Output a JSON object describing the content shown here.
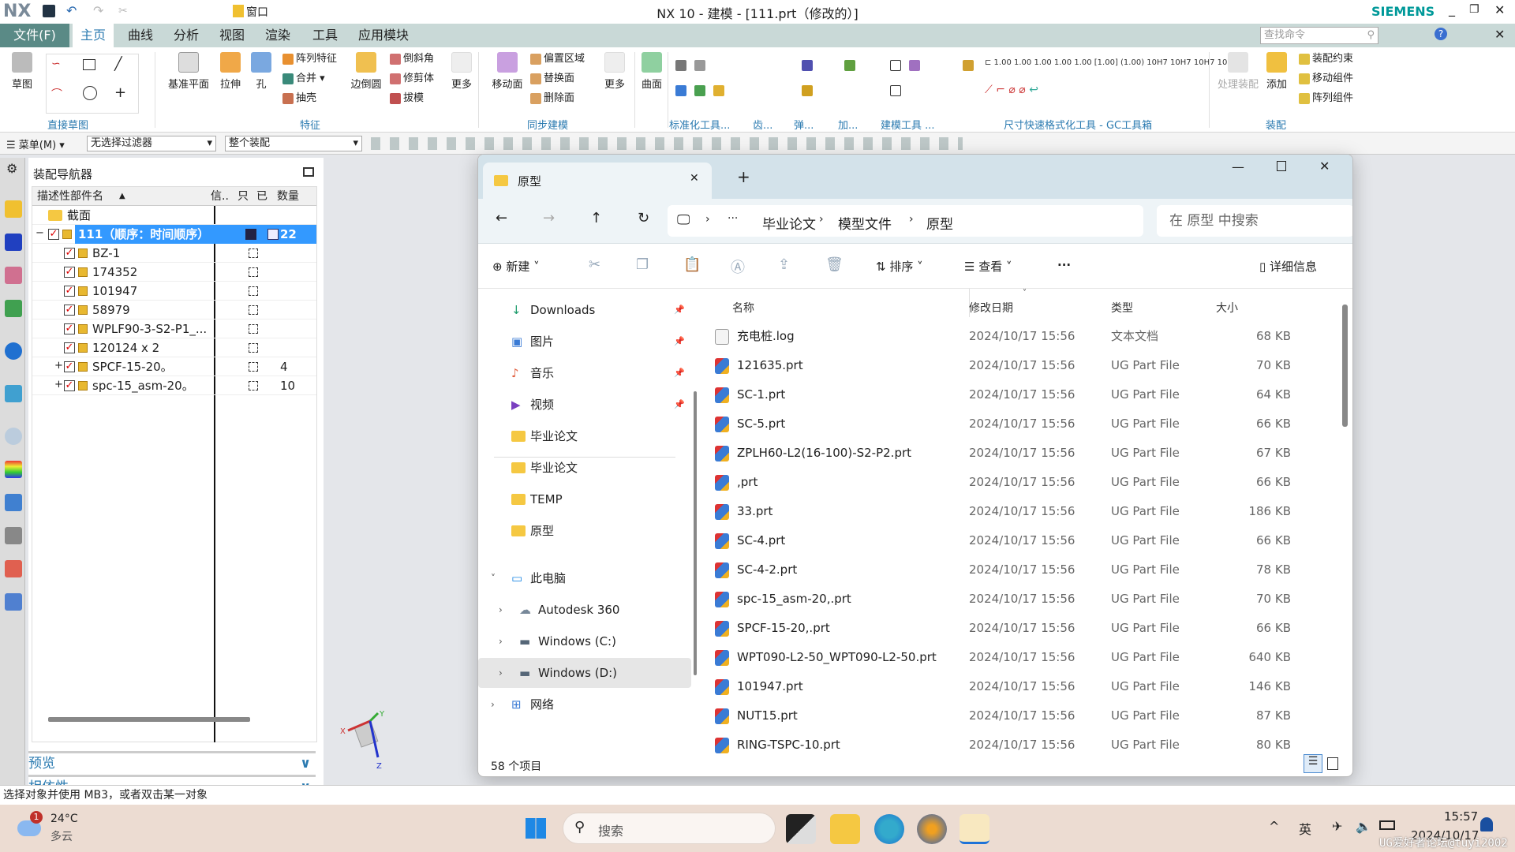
{
  "app": {
    "logo": "NX",
    "title": "NX 10 - 建模 - [111.prt（修改的）]",
    "brand": "SIEMENS",
    "window_menu": "窗口",
    "search_placeholder": "查找命令"
  },
  "menu_tabs": [
    {
      "label": "文件(F)"
    },
    {
      "label": "主页",
      "active": true
    },
    {
      "label": "曲线"
    },
    {
      "label": "分析"
    },
    {
      "label": "视图"
    },
    {
      "label": "渲染"
    },
    {
      "label": "工具"
    },
    {
      "label": "应用模块"
    }
  ],
  "ribbon": {
    "groups": [
      "直接草图",
      "特征",
      "同步建模",
      "标准化工具...",
      "齿...",
      "弹...",
      "加...",
      "建模工具 ...",
      "尺寸快速格式化工具 - GC工具箱",
      "装配"
    ],
    "sketch": "草图",
    "features": {
      "datum": "基准平面",
      "extrude": "拉伸",
      "hole": "孔",
      "pattern": "阵列特征",
      "unite": "合并",
      "shell": "抽壳",
      "edge_blend": "边倒圆",
      "chamfer": "倒斜角",
      "trim": "修剪体",
      "draft": "拔模",
      "more": "更多"
    },
    "sync": {
      "move_face": "移动面",
      "offset": "偏置区域",
      "replace": "替换面",
      "delete": "删除面",
      "more": "更多"
    },
    "surface": "曲面",
    "assembly": {
      "process": "处理装配",
      "add": "添加",
      "constraint": "装配约束",
      "move": "移动组件",
      "pattern": "阵列组件"
    }
  },
  "toolbar2": {
    "menu": "菜单(M)",
    "filter": "无选择过滤器",
    "scope": "整个装配"
  },
  "navigator": {
    "title": "装配导航器",
    "columns": [
      "描述性部件名",
      "信..",
      "只",
      "已",
      "数量"
    ],
    "rows": [
      {
        "name": "截面",
        "type": "folder"
      },
      {
        "name": "111（顺序：时间顺序）",
        "qty": "22",
        "selected": true,
        "expand": "−"
      },
      {
        "name": "BZ-1"
      },
      {
        "name": "174352"
      },
      {
        "name": "101947"
      },
      {
        "name": "58979"
      },
      {
        "name": "WPLF90-3-S2-P1_..."
      },
      {
        "name": "120124 x 2"
      },
      {
        "name": "SPCF-15-20。",
        "qty": "4",
        "expand": "+"
      },
      {
        "name": "spc-15_asm-20。",
        "qty": "10",
        "expand": "+"
      }
    ],
    "preview": "预览",
    "dependency": "相依性"
  },
  "status": "选择对象并使用 MB3，或者双击某一对象",
  "triad": {
    "x": "X",
    "y": "Y",
    "z": "Z"
  },
  "explorer": {
    "tab": "原型",
    "new_tab": "+",
    "breadcrumb": [
      "毕业论文",
      "模型文件",
      "原型"
    ],
    "search_placeholder": "在 原型 中搜索",
    "cmd": {
      "new": "新建",
      "sort": "排序",
      "view": "查看",
      "more": "···",
      "details": "详细信息"
    },
    "nav": [
      {
        "label": "Downloads",
        "pin": true
      },
      {
        "label": "图片",
        "pin": true
      },
      {
        "label": "音乐",
        "pin": true
      },
      {
        "label": "视频",
        "pin": true
      },
      {
        "label": "毕业论文"
      },
      {
        "label": "毕业论文"
      },
      {
        "label": "TEMP"
      },
      {
        "label": "原型"
      },
      {
        "label": "此电脑",
        "expanded": true
      },
      {
        "label": "Autodesk 360"
      },
      {
        "label": "Windows (C:)"
      },
      {
        "label": "Windows (D:)",
        "selected": true
      },
      {
        "label": "网络"
      }
    ],
    "columns": [
      "名称",
      "修改日期",
      "类型",
      "大小"
    ],
    "files": [
      {
        "name": "充电桩.log",
        "date": "2024/10/17 15:56",
        "type": "文本文档",
        "size": "68 KB"
      },
      {
        "name": "121635.prt",
        "date": "2024/10/17 15:56",
        "type": "UG Part File",
        "size": "70 KB"
      },
      {
        "name": "SC-1.prt",
        "date": "2024/10/17 15:56",
        "type": "UG Part File",
        "size": "64 KB"
      },
      {
        "name": "SC-5.prt",
        "date": "2024/10/17 15:56",
        "type": "UG Part File",
        "size": "66 KB"
      },
      {
        "name": "ZPLH60-L2(16-100)-S2-P2.prt",
        "date": "2024/10/17 15:56",
        "type": "UG Part File",
        "size": "67 KB"
      },
      {
        "name": ",prt",
        "date": "2024/10/17 15:56",
        "type": "UG Part File",
        "size": "66 KB"
      },
      {
        "name": "33.prt",
        "date": "2024/10/17 15:56",
        "type": "UG Part File",
        "size": "186 KB"
      },
      {
        "name": "SC-4.prt",
        "date": "2024/10/17 15:56",
        "type": "UG Part File",
        "size": "66 KB"
      },
      {
        "name": "SC-4-2.prt",
        "date": "2024/10/17 15:56",
        "type": "UG Part File",
        "size": "78 KB"
      },
      {
        "name": "spc-15_asm-20,.prt",
        "date": "2024/10/17 15:56",
        "type": "UG Part File",
        "size": "70 KB"
      },
      {
        "name": "SPCF-15-20,.prt",
        "date": "2024/10/17 15:56",
        "type": "UG Part File",
        "size": "66 KB"
      },
      {
        "name": "WPT090-L2-50_WPT090-L2-50.prt",
        "date": "2024/10/17 15:56",
        "type": "UG Part File",
        "size": "640 KB"
      },
      {
        "name": "101947.prt",
        "date": "2024/10/17 15:56",
        "type": "UG Part File",
        "size": "146 KB"
      },
      {
        "name": "NUT15.prt",
        "date": "2024/10/17 15:56",
        "type": "UG Part File",
        "size": "87 KB"
      },
      {
        "name": "RING-TSPC-10.prt",
        "date": "2024/10/17 15:56",
        "type": "UG Part File",
        "size": "80 KB"
      }
    ],
    "item_count": "58 个项目"
  },
  "taskbar": {
    "weather_temp": "24°C",
    "weather_desc": "多云",
    "weather_badge": "1",
    "search": "搜索",
    "ime": "英",
    "time": "15:57",
    "date": "2024/10/17",
    "watermark": "UG爱好者论坛@tuyi2002"
  },
  "colors": {
    "accent": "#2a7ab0",
    "selected_row": "#3399ff",
    "file_tab": "#5a8a86",
    "brand": "#009999"
  }
}
